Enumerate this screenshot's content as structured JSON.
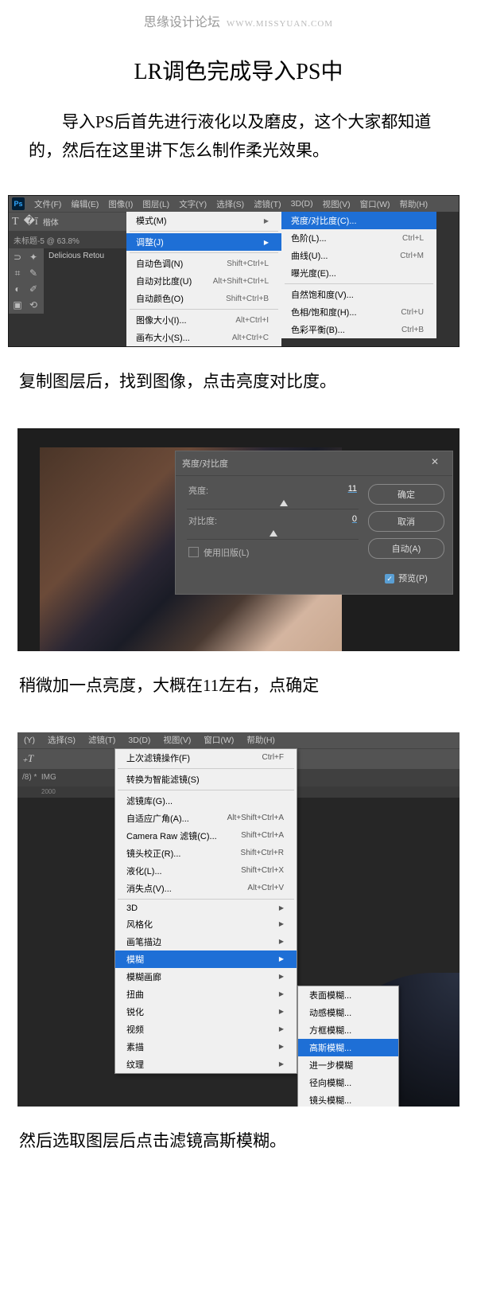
{
  "watermark": {
    "site": "思缘设计论坛",
    "url": "WWW.MISSYUAN.COM"
  },
  "title": "LR调色完成导入PS中",
  "intro": "导入PS后首先进行液化以及磨皮，这个大家都知道的，然后在这里讲下怎么制作柔光效果。",
  "ps1": {
    "menus": [
      "文件(F)",
      "编辑(E)",
      "图像(I)",
      "图层(L)",
      "文字(Y)",
      "选择(S)",
      "滤镜(T)",
      "3D(D)",
      "视图(V)",
      "窗口(W)",
      "帮助(H)"
    ],
    "optbar": {
      "font": "楷体"
    },
    "tab": "未标题-5 @ 63.8%",
    "layertab": "Delicious Retou",
    "imageMenu": [
      {
        "label": "模式(M)",
        "arrow": true
      },
      {
        "sep": true
      },
      {
        "label": "调整(J)",
        "arrow": true,
        "hi": true
      },
      {
        "sep": true
      },
      {
        "label": "自动色调(N)",
        "sc": "Shift+Ctrl+L"
      },
      {
        "label": "自动对比度(U)",
        "sc": "Alt+Shift+Ctrl+L"
      },
      {
        "label": "自动颜色(O)",
        "sc": "Shift+Ctrl+B"
      },
      {
        "sep": true
      },
      {
        "label": "图像大小(I)...",
        "sc": "Alt+Ctrl+I"
      },
      {
        "label": "画布大小(S)...",
        "sc": "Alt+Ctrl+C"
      }
    ],
    "adjMenu": [
      {
        "label": "亮度/对比度(C)...",
        "hi": true
      },
      {
        "label": "色阶(L)...",
        "sc": "Ctrl+L"
      },
      {
        "label": "曲线(U)...",
        "sc": "Ctrl+M"
      },
      {
        "label": "曝光度(E)..."
      },
      {
        "sep": true
      },
      {
        "label": "自然饱和度(V)..."
      },
      {
        "label": "色相/饱和度(H)...",
        "sc": "Ctrl+U"
      },
      {
        "label": "色彩平衡(B)...",
        "sc": "Ctrl+B"
      }
    ]
  },
  "caption1": "复制图层后，找到图像，点击亮度对比度。",
  "dialog": {
    "title": "亮度/对比度",
    "brightness": {
      "label": "亮度:",
      "value": "11"
    },
    "contrast": {
      "label": "对比度:",
      "value": "0"
    },
    "legacy": "使用旧版(L)",
    "ok": "确定",
    "cancel": "取消",
    "auto": "自动(A)",
    "preview": "预览(P)"
  },
  "caption2": "稍微加一点亮度，大概在11左右，点确定",
  "ps3": {
    "menus": [
      "(Y)",
      "选择(S)",
      "滤镜(T)",
      "3D(D)",
      "视图(V)",
      "窗口(W)",
      "帮助(H)"
    ],
    "tab_prefix": "/8) *",
    "tab": "IMG",
    "tick": "2000",
    "filterMenu": [
      {
        "label": "上次滤镜操作(F)",
        "sc": "Ctrl+F"
      },
      {
        "sep": true
      },
      {
        "label": "转换为智能滤镜(S)"
      },
      {
        "sep": true
      },
      {
        "label": "滤镜库(G)..."
      },
      {
        "label": "自适应广角(A)...",
        "sc": "Alt+Shift+Ctrl+A"
      },
      {
        "label": "Camera Raw 滤镜(C)...",
        "sc": "Shift+Ctrl+A"
      },
      {
        "label": "镜头校正(R)...",
        "sc": "Shift+Ctrl+R"
      },
      {
        "label": "液化(L)...",
        "sc": "Shift+Ctrl+X"
      },
      {
        "label": "消失点(V)...",
        "sc": "Alt+Ctrl+V"
      },
      {
        "sep": true
      },
      {
        "label": "3D",
        "arrow": true
      },
      {
        "label": "风格化",
        "arrow": true
      },
      {
        "label": "画笔描边",
        "arrow": true
      },
      {
        "label": "模糊",
        "arrow": true,
        "hi": true
      },
      {
        "label": "模糊画廊",
        "arrow": true
      },
      {
        "label": "扭曲",
        "arrow": true
      },
      {
        "label": "锐化",
        "arrow": true
      },
      {
        "label": "视频",
        "arrow": true
      },
      {
        "label": "素描",
        "arrow": true
      },
      {
        "label": "纹理",
        "arrow": true
      }
    ],
    "blurMenu": [
      {
        "label": "表面模糊..."
      },
      {
        "label": "动感模糊..."
      },
      {
        "label": "方框模糊..."
      },
      {
        "label": "高斯模糊...",
        "hi": true
      },
      {
        "label": "进一步模糊"
      },
      {
        "label": "径向模糊..."
      },
      {
        "label": "镜头模糊..."
      }
    ]
  },
  "caption3": "然后选取图层后点击滤镜高斯模糊。"
}
